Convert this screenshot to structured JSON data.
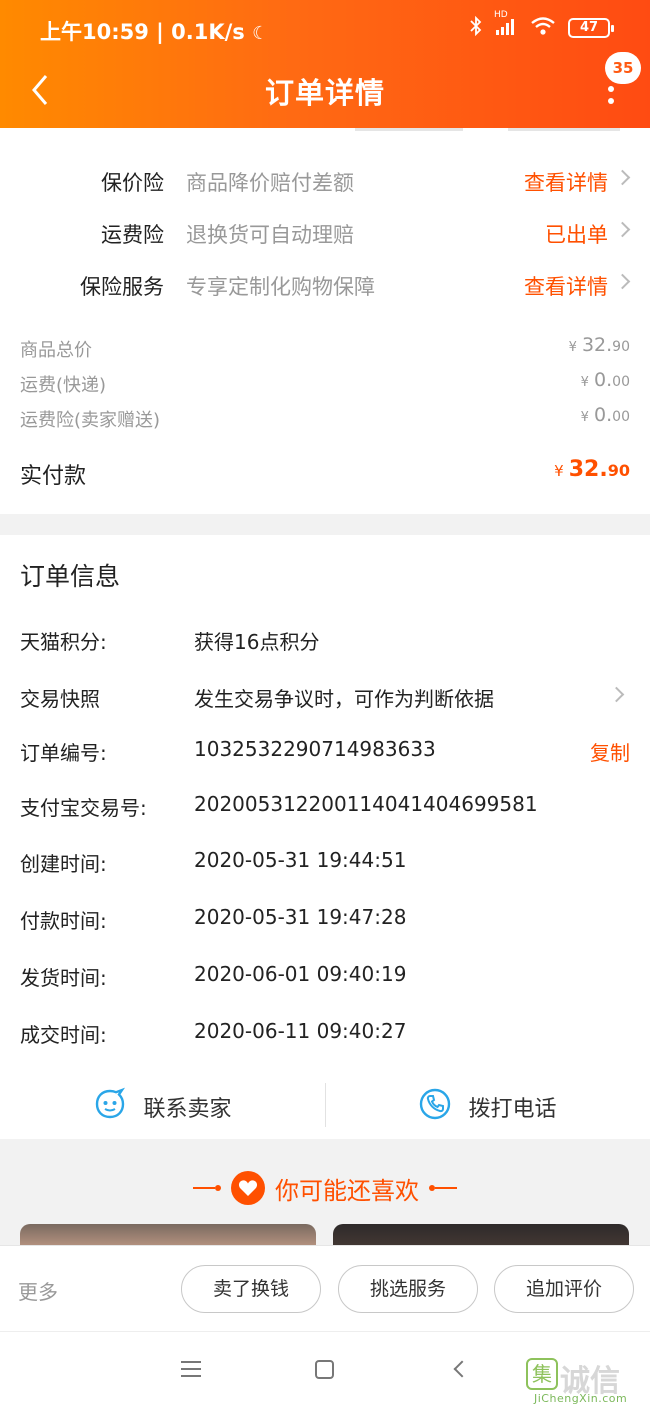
{
  "status_bar": {
    "time": "上午10:59",
    "speed": "0.1K/s",
    "network": "HD",
    "battery": "47"
  },
  "nav": {
    "title": "订单详情",
    "badge": "35"
  },
  "insurance": [
    {
      "label": "保价险",
      "desc": "商品降价赔付差额",
      "action": "查看详情"
    },
    {
      "label": "运费险",
      "desc": "退换货可自动理赔",
      "action": "已出单"
    },
    {
      "label": "保险服务",
      "desc": "专享定制化购物保障",
      "action": "查看详情"
    }
  ],
  "prices": [
    {
      "label": "商品总价",
      "currency": "¥",
      "int": "32.",
      "dec": "90"
    },
    {
      "label": "运费(快递)",
      "currency": "¥",
      "int": "0.",
      "dec": "00"
    },
    {
      "label": "运费险(卖家赠送)",
      "currency": "¥",
      "int": "0.",
      "dec": "00"
    }
  ],
  "total": {
    "label": "实付款",
    "currency": "¥",
    "int": "32.",
    "dec": "90"
  },
  "order_info": {
    "title": "订单信息",
    "rows": [
      {
        "label": "天猫积分:",
        "value": "获得16点积分"
      },
      {
        "label": "交易快照",
        "value": "发生交易争议时，可作为判断依据"
      },
      {
        "label": "订单编号:",
        "value": "1032532290714983633",
        "action": "复制"
      },
      {
        "label": "支付宝交易号:",
        "value": "2020053122001140414046995​81"
      },
      {
        "label": "创建时间:",
        "value": "2020-05-31 19:44:51"
      },
      {
        "label": "付款时间:",
        "value": "2020-05-31 19:47:28"
      },
      {
        "label": "发货时间:",
        "value": "2020-06-01 09:40:19"
      },
      {
        "label": "成交时间:",
        "value": "2020-06-11 09:40:27"
      }
    ]
  },
  "contact": {
    "seller": "联系卖家",
    "phone": "拨打电话"
  },
  "recommend": {
    "title": "你可能还喜欢"
  },
  "actions": {
    "more": "更多",
    "buttons": [
      "卖了换钱",
      "挑选服务",
      "追加评价"
    ]
  },
  "watermark": {
    "main": "诚信",
    "logo": "集",
    "sub": "JiChengXin.com"
  },
  "colors": {
    "accent": "#ff5000",
    "header_start": "#ff8a00",
    "header_end": "#ff4b12",
    "icon_blue": "#2aa6e8"
  }
}
